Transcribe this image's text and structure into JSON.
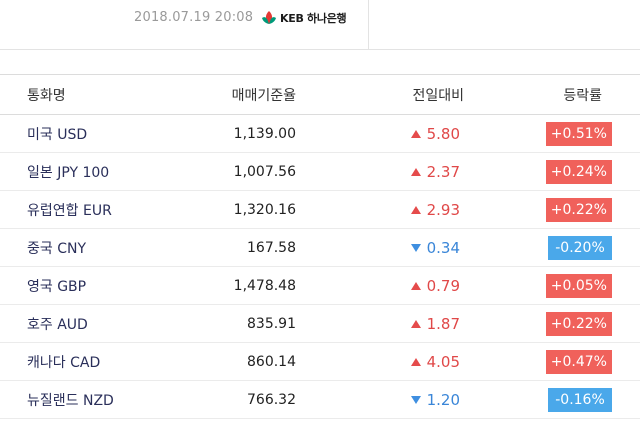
{
  "header": {
    "timestamp": "2018.07.19 20:08",
    "bank_name": "KEB 하나은행"
  },
  "columns": [
    "통화명",
    "매매기준율",
    "전일대비",
    "등락률"
  ],
  "colors": {
    "up": "#e54b4b",
    "down": "#3f8fe0",
    "badge_up": "#f0615b",
    "badge_down": "#4aa8ea"
  },
  "rows": [
    {
      "name": "미국 USD",
      "rate": "1,139.00",
      "direction": "up",
      "change": "5.80",
      "pct": "+0.51%"
    },
    {
      "name": "일본 JPY 100",
      "rate": "1,007.56",
      "direction": "up",
      "change": "2.37",
      "pct": "+0.24%"
    },
    {
      "name": "유럽연합 EUR",
      "rate": "1,320.16",
      "direction": "up",
      "change": "2.93",
      "pct": "+0.22%"
    },
    {
      "name": "중국 CNY",
      "rate": "167.58",
      "direction": "down",
      "change": "0.34",
      "pct": "-0.20%"
    },
    {
      "name": "영국 GBP",
      "rate": "1,478.48",
      "direction": "up",
      "change": "0.79",
      "pct": "+0.05%"
    },
    {
      "name": "호주 AUD",
      "rate": "835.91",
      "direction": "up",
      "change": "1.87",
      "pct": "+0.22%"
    },
    {
      "name": "캐나다 CAD",
      "rate": "860.14",
      "direction": "up",
      "change": "4.05",
      "pct": "+0.47%"
    },
    {
      "name": "뉴질랜드 NZD",
      "rate": "766.32",
      "direction": "down",
      "change": "1.20",
      "pct": "-0.16%"
    }
  ]
}
